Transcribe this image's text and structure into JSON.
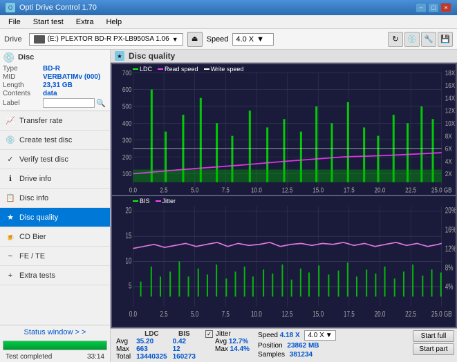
{
  "titlebar": {
    "title": "Opti Drive Control 1.70",
    "icon": "O",
    "buttons": [
      "−",
      "□",
      "×"
    ]
  },
  "menubar": {
    "items": [
      "File",
      "Start test",
      "Extra",
      "Help"
    ]
  },
  "drivebar": {
    "label": "Drive",
    "drive_name": "(E:) PLEXTOR BD-R  PX-LB950SA 1.06",
    "speed_label": "Speed",
    "speed_value": "4.0 X"
  },
  "sidebar": {
    "disc_section": {
      "title": "Disc",
      "type_label": "Type",
      "type_value": "BD-R",
      "mid_label": "MID",
      "mid_value": "VERBATIMv (000)",
      "length_label": "Length",
      "length_value": "23,31 GB",
      "contents_label": "Contents",
      "contents_value": "data",
      "label_label": "Label"
    },
    "nav_items": [
      {
        "id": "transfer-rate",
        "label": "Transfer rate",
        "icon": "📈"
      },
      {
        "id": "create-test-disc",
        "label": "Create test disc",
        "icon": "💿"
      },
      {
        "id": "verify-test-disc",
        "label": "Verify test disc",
        "icon": "✓"
      },
      {
        "id": "drive-info",
        "label": "Drive info",
        "icon": "ℹ"
      },
      {
        "id": "disc-info",
        "label": "Disc info",
        "icon": "📋"
      },
      {
        "id": "disc-quality",
        "label": "Disc quality",
        "icon": "★",
        "active": true
      },
      {
        "id": "cd-bier",
        "label": "CD Bier",
        "icon": "🍺"
      },
      {
        "id": "fe-te",
        "label": "FE / TE",
        "icon": "~"
      },
      {
        "id": "extra-tests",
        "label": "Extra tests",
        "icon": "+"
      }
    ],
    "status": {
      "btn_label": "Status window > >",
      "progress_percent": 100,
      "status_text": "Test completed",
      "time": "33:14"
    }
  },
  "main": {
    "panel_title": "Disc quality",
    "chart_top": {
      "legend": [
        {
          "label": "LDC",
          "color": "#00ff00"
        },
        {
          "label": "Read speed",
          "color": "#ff00ff"
        },
        {
          "label": "Write speed",
          "color": "#ffffff"
        }
      ],
      "y_labels": [
        "700",
        "600",
        "500",
        "400",
        "300",
        "200",
        "100"
      ],
      "y_labels_right": [
        "18X",
        "16X",
        "14X",
        "12X",
        "10X",
        "8X",
        "6X",
        "4X",
        "2X"
      ],
      "x_labels": [
        "0.0",
        "2.5",
        "5.0",
        "7.5",
        "10.0",
        "12.5",
        "15.0",
        "17.5",
        "20.0",
        "22.5",
        "25.0 GB"
      ]
    },
    "chart_bottom": {
      "legend": [
        {
          "label": "BIS",
          "color": "#00ff00"
        },
        {
          "label": "Jitter",
          "color": "#ff00ff"
        }
      ],
      "y_labels": [
        "20",
        "15",
        "10",
        "5"
      ],
      "y_labels_right": [
        "20%",
        "16%",
        "12%",
        "8%",
        "4%"
      ],
      "x_labels": [
        "0.0",
        "2.5",
        "5.0",
        "7.5",
        "10.0",
        "12.5",
        "15.0",
        "17.5",
        "20.0",
        "22.5",
        "25.0 GB"
      ]
    },
    "stats": {
      "headers": [
        "LDC",
        "BIS"
      ],
      "avg_label": "Avg",
      "avg_ldc": "35.20",
      "avg_bis": "0.42",
      "max_label": "Max",
      "max_ldc": "663",
      "max_bis": "12",
      "total_label": "Total",
      "total_ldc": "13440325",
      "total_bis": "160273",
      "jitter_label": "Jitter",
      "jitter_avg": "12.7%",
      "jitter_max": "14.4%",
      "jitter_checked": true,
      "speed_label": "Speed",
      "speed_val": "4.18 X",
      "speed_dropdown": "4.0 X",
      "position_label": "Position",
      "position_val": "23862 MB",
      "samples_label": "Samples",
      "samples_val": "381234",
      "start_full_label": "Start full",
      "start_part_label": "Start part"
    }
  }
}
